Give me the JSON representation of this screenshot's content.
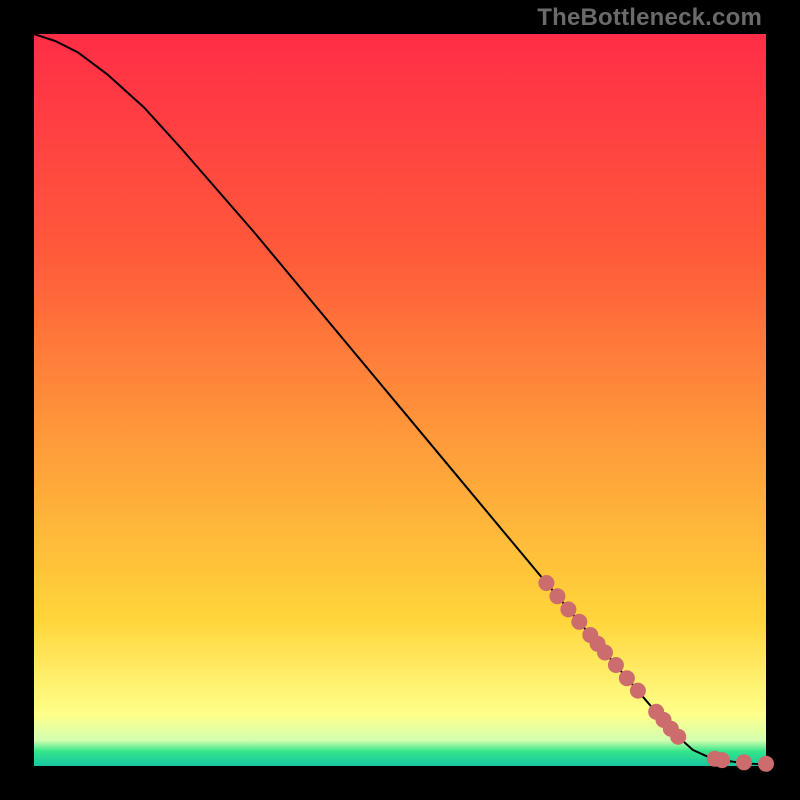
{
  "watermark": "TheBottleneck.com",
  "colors": {
    "gradient": {
      "c0": "#ff2d47",
      "c1": "#ff5a3a",
      "c2": "#ff993a",
      "c3": "#ffd53a",
      "c4": "#ffff8a",
      "c5": "#d3ffb0",
      "c6": "#35e58a",
      "c7": "#17c6a0"
    },
    "curve": "#000000",
    "dot": "#cc6c6c"
  },
  "chart_data": {
    "type": "line",
    "title": "",
    "xlabel": "",
    "ylabel": "",
    "xlim": [
      0,
      100
    ],
    "ylim": [
      0,
      100
    ],
    "grid": false,
    "legend": false,
    "series": [
      {
        "name": "bottleneck-curve",
        "x": [
          0,
          3,
          6,
          10,
          15,
          20,
          30,
          40,
          50,
          60,
          70,
          78,
          84,
          88,
          90,
          92,
          94,
          96,
          98,
          100
        ],
        "y": [
          100,
          99,
          97.5,
          94.5,
          90,
          84.5,
          73,
          61,
          49,
          37,
          25,
          15.5,
          8.5,
          4,
          2.2,
          1.3,
          0.8,
          0.5,
          0.3,
          0.2
        ]
      }
    ],
    "points_on_curve": [
      {
        "x": 70.0,
        "y": 25.0
      },
      {
        "x": 71.5,
        "y": 23.2
      },
      {
        "x": 73.0,
        "y": 21.4
      },
      {
        "x": 74.5,
        "y": 19.7
      },
      {
        "x": 76.0,
        "y": 17.9
      },
      {
        "x": 77.0,
        "y": 16.7
      },
      {
        "x": 78.0,
        "y": 15.5
      },
      {
        "x": 79.5,
        "y": 13.8
      },
      {
        "x": 81.0,
        "y": 12.0
      },
      {
        "x": 82.5,
        "y": 10.3
      },
      {
        "x": 85.0,
        "y": 7.4
      },
      {
        "x": 86.0,
        "y": 6.3
      },
      {
        "x": 87.0,
        "y": 5.1
      },
      {
        "x": 88.0,
        "y": 4.0
      },
      {
        "x": 93.0,
        "y": 1.0
      },
      {
        "x": 94.0,
        "y": 0.8
      },
      {
        "x": 97.0,
        "y": 0.5
      },
      {
        "x": 100.0,
        "y": 0.3
      }
    ]
  }
}
